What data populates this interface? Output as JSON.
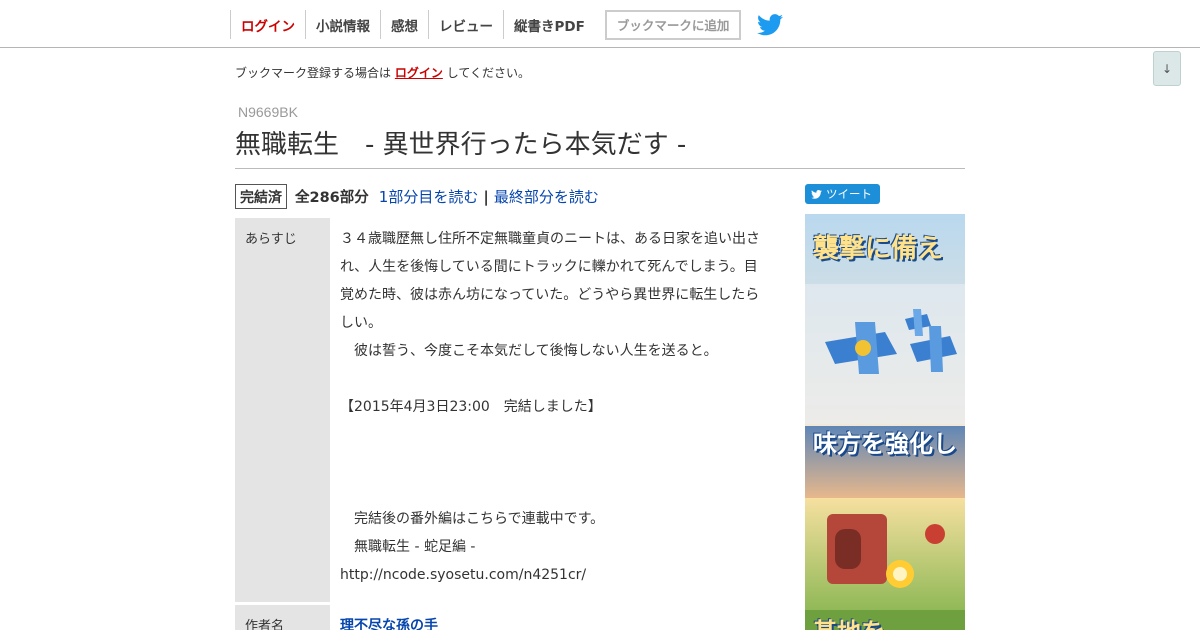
{
  "header": {
    "nav": [
      {
        "label": "ログイン",
        "name": "nav-login"
      },
      {
        "label": "小説情報",
        "name": "nav-novel-info"
      },
      {
        "label": "感想",
        "name": "nav-impressions"
      },
      {
        "label": "レビュー",
        "name": "nav-review"
      },
      {
        "label": "縦書きPDF",
        "name": "nav-vertical-pdf"
      }
    ],
    "bookmark_button": "ブックマークに追加",
    "twitter_icon": "twitter-bird-icon",
    "scroll_button": "↓"
  },
  "notice": {
    "before": "ブックマーク登録する場合は",
    "link": "ログイン",
    "after": "してください。"
  },
  "novel": {
    "ncode": "N9669BK",
    "title": "無職転生　- 異世界行ったら本気だす -",
    "status_badge": "完結済",
    "total_parts": "全286部分",
    "read_first": "1部分目を読む",
    "separator": "|",
    "read_last": "最終部分を読む"
  },
  "info": {
    "synopsis_label": "あらすじ",
    "synopsis_lines": [
      "３４歳職歴無し住所不定無職童貞のニートは、ある日家を追い出さ",
      "れ、人生を後悔している間にトラックに轢かれて死んでしまう。目",
      "覚めた時、彼は赤ん坊になっていた。どうやら異世界に転生したら",
      "しい。",
      "　彼は誓う、今度こそ本気だして後悔しない人生を送ると。",
      "",
      "【2015年4月3日23:00　完結しました】",
      "",
      "",
      "",
      "　完結後の番外編はこちらで連載中です。",
      "　無職転生 - 蛇足編 -",
      "http://ncode.syosetu.com/n4251cr/"
    ],
    "author_label": "作者名",
    "author": "理不尽な孫の手"
  },
  "sidebar": {
    "tweet_button": "ツイート",
    "ad_texts": [
      "襲撃に備え",
      "味方を強化し",
      "基地を"
    ]
  },
  "colors": {
    "login_red": "#cc0000",
    "link_blue": "#0645ad",
    "twitter_blue": "#1d9bf0",
    "label_bg": "#e4e4e4"
  }
}
